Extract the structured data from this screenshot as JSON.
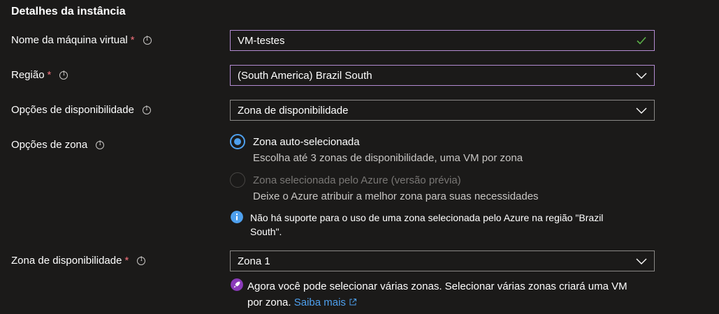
{
  "section": {
    "title": "Detalhes da instância"
  },
  "vm_name": {
    "label": "Nome da máquina virtual",
    "required": "*",
    "value": "VM-testes"
  },
  "region": {
    "label": "Região",
    "required": "*",
    "value": "(South America) Brazil South"
  },
  "availability_options": {
    "label": "Opções de disponibilidade",
    "value": "Zona de disponibilidade"
  },
  "zone_options": {
    "label": "Opções de zona",
    "auto": {
      "title": "Zona auto-selecionada",
      "desc": "Escolha até 3 zonas de disponibilidade, uma VM por zona",
      "selected": true
    },
    "azure": {
      "title": "Zona selecionada pelo Azure (versão prévia)",
      "desc": "Deixe o Azure atribuir a melhor zona para suas necessidades",
      "selected": false
    },
    "info_line1": "Não há suporte para o uso de uma zona selecionada pelo Azure na região \"Brazil",
    "info_line2": "South\"."
  },
  "availability_zone": {
    "label": "Zona de disponibilidade",
    "required": "*",
    "value": "Zona 1",
    "notice_line1": "Agora você pode selecionar várias zonas. Selecionar várias zonas criará uma VM",
    "notice_line2": "por zona.",
    "learn_more": "Saiba mais"
  },
  "colors": {
    "accent": "#4ea0ee",
    "required": "#f1707b",
    "focus_border": "#b38bd1",
    "success": "#5bb048",
    "notice_purple": "#8a3ab9"
  },
  "icons": [
    "info-icon",
    "checkmark-icon",
    "chevron-down-icon",
    "info-filled-icon",
    "rocket-icon",
    "external-link-icon"
  ]
}
